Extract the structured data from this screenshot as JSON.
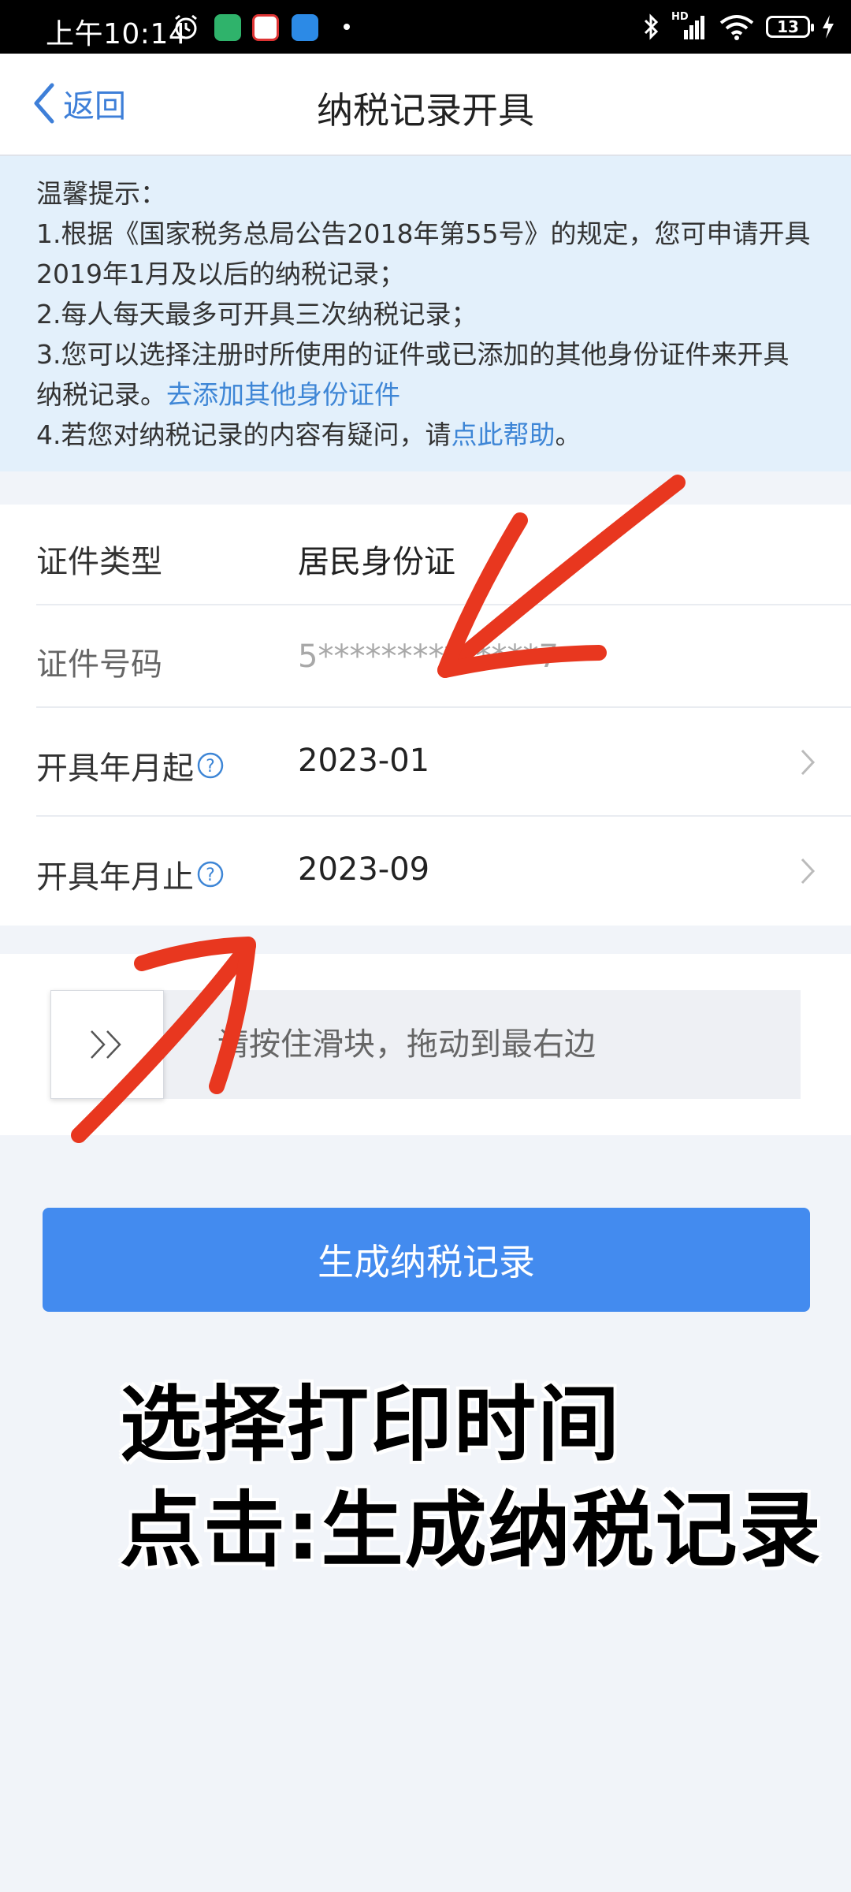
{
  "status_bar": {
    "time": "上午10:14",
    "signal": "HD",
    "battery": "13"
  },
  "nav": {
    "back_label": "返回",
    "title": "纳税记录开具"
  },
  "notice": {
    "heading": "温馨提示：",
    "line1": "1.根据《国家税务总局公告2018年第55号》的规定，您可申请开具2019年1月及以后的纳税记录；",
    "line2": "2.每人每天最多可开具三次纳税记录；",
    "line3_text": "3.您可以选择注册时所使用的证件或已添加的其他身份证件来开具纳税记录。",
    "line3_link": "去添加其他身份证件",
    "line4_text": "4.若您对纳税记录的内容有疑问，请",
    "line4_link": "点此帮助",
    "line4_end": "。"
  },
  "form": {
    "id_type_label": "证件类型",
    "id_type_value": "居民身份证",
    "id_number_label": "证件号码",
    "id_number_value": "5**************7",
    "start_label": "开具年月起",
    "start_value": "2023-01",
    "end_label": "开具年月止",
    "end_value": "2023-09"
  },
  "slider": {
    "hint": "请按住滑块，拖动到最右边"
  },
  "primary_button": "生成纳税记录",
  "annotation": {
    "line1": "选择打印时间",
    "line2": "点击:生成纳税记录"
  },
  "colors": {
    "accent": "#438bef",
    "link": "#3e86d6",
    "notice_bg": "#e3f0fb",
    "annotation_arrow": "#e8371f"
  }
}
